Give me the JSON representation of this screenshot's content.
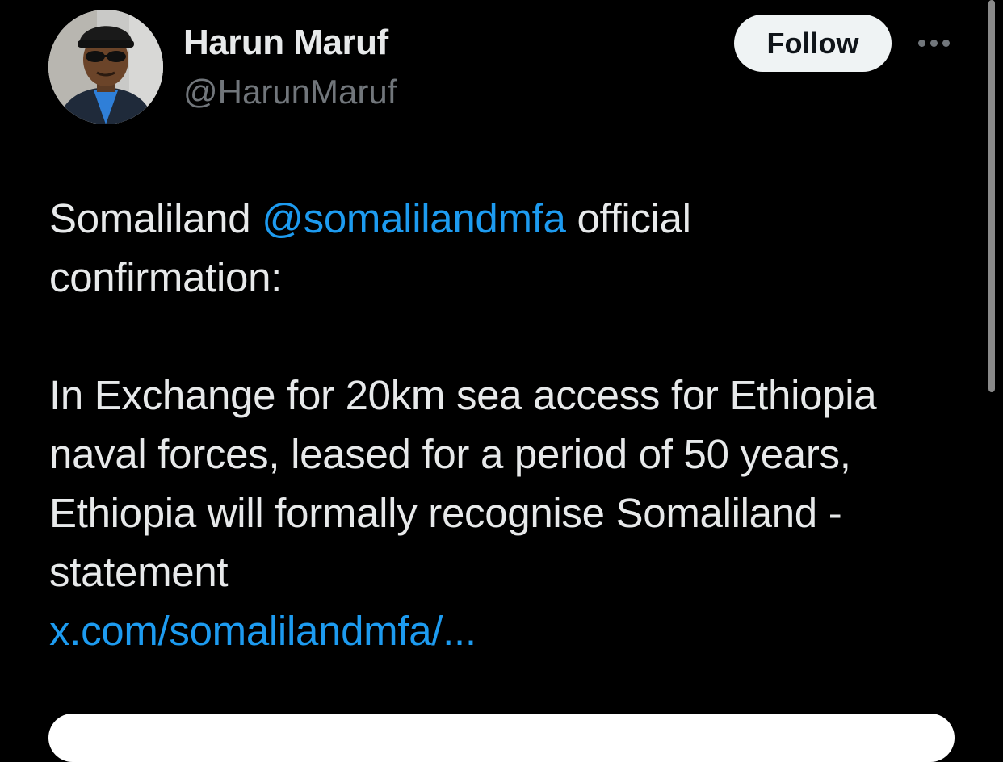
{
  "author": {
    "display_name": "Harun Maruf",
    "handle": "@HarunMaruf",
    "avatar_icon": "user-avatar-photo"
  },
  "actions": {
    "follow_label": "Follow",
    "more_icon": "more-horizontal-icon"
  },
  "tweet": {
    "line1_prefix": "Somaliland ",
    "mention": "@somalilandmfa",
    "line1_suffix": " official",
    "line2": "confirmation:",
    "paragraph2": "In Exchange for 20km sea access for Ethiopia naval forces, leased for a period of 50 years, Ethiopia will formally recognise Somaliland - statement",
    "link": "x.com/somalilandmfa/..."
  },
  "colors": {
    "background": "#000000",
    "text": "#e7e9ea",
    "secondary_text": "#71767b",
    "link": "#1d9bf0",
    "follow_bg": "#eff3f4"
  }
}
